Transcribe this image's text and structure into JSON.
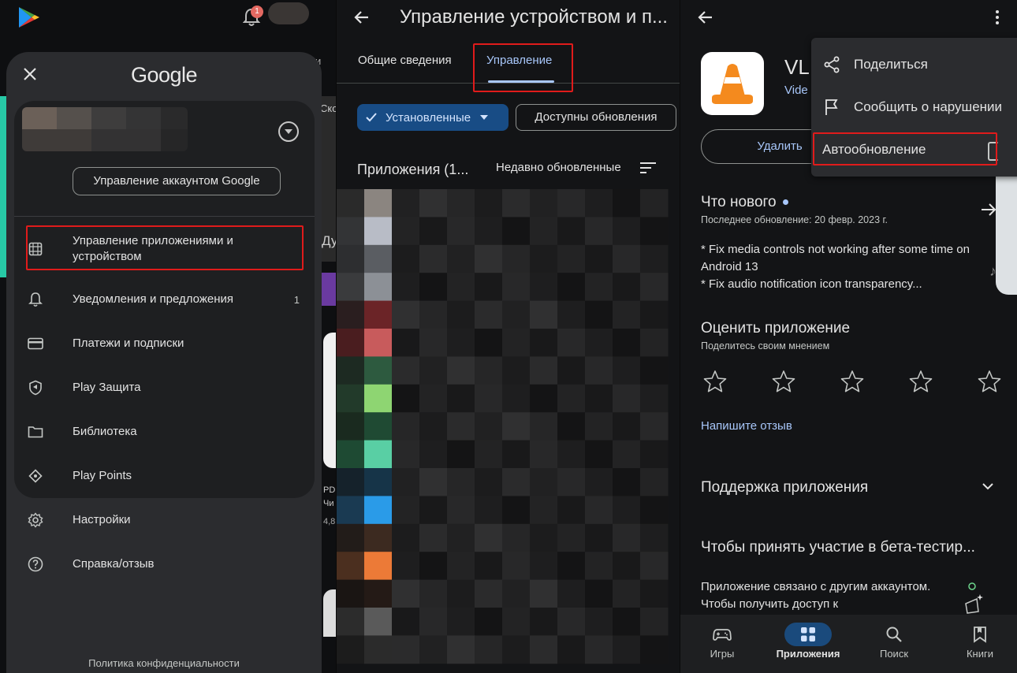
{
  "panel1": {
    "notification_count": "1",
    "drawer": {
      "logo": "Google",
      "manage_account_label": "Управление аккаунтом Google",
      "menu": [
        {
          "label": "Управление приложениями и устройством",
          "icon": "grid-icon"
        },
        {
          "label": "Уведомления и предложения",
          "icon": "bell-icon",
          "count": "1"
        },
        {
          "label": "Платежи и подписки",
          "icon": "credit-card-icon"
        },
        {
          "label": "Play Защита",
          "icon": "shield-icon"
        },
        {
          "label": "Библиотека",
          "icon": "folder-icon"
        },
        {
          "label": "Play Points",
          "icon": "diamond-icon"
        },
        {
          "label": "Настройки",
          "icon": "gear-icon"
        },
        {
          "label": "Справка/отзыв",
          "icon": "help-icon"
        }
      ],
      "privacy_link": "Политика конфиденциальности"
    },
    "background_fragments": {
      "tab_tail": "и",
      "card_label_1": "Ско",
      "card_letter": "Ду",
      "card_label_2": "PD",
      "card_label_3": "Чи",
      "card_rating": "4,8"
    }
  },
  "panel2": {
    "title": "Управление устройством и п...",
    "tabs": [
      {
        "label": "Общие сведения",
        "active": false
      },
      {
        "label": "Управление",
        "active": true
      }
    ],
    "filter_installed": "Установленные",
    "filter_updates": "Доступны обновления",
    "apps_count_label": "Приложения (1...",
    "sort_label": "Недавно обновленные",
    "accent_color": "#a8c7fa"
  },
  "panel3": {
    "app_name": "VL",
    "developer": "Vide",
    "uninstall_label": "Удалить",
    "menu": [
      {
        "label": "Поделиться",
        "icon": "share-icon"
      },
      {
        "label": "Сообщить о нарушении",
        "icon": "flag-icon"
      },
      {
        "label": "Автообновление",
        "icon": "checkbox-icon"
      }
    ],
    "whats_new_title": "Что нового",
    "last_update": "Последнее обновление: 20 февр. 2023 г.",
    "changelog": [
      "* Fix media controls not working after some time on Android 13",
      "* Fix audio notification icon transparency..."
    ],
    "rate_title": "Оценить приложение",
    "rate_subtitle": "Поделитесь своим мнением",
    "star_count": 5,
    "write_review": "Напишите отзыв",
    "support_title": "Поддержка приложения",
    "beta_title": "Чтобы принять участие в бета-тестир...",
    "beta_desc": "Приложение связано с другим аккаунтом. Чтобы получить доступ к",
    "bottom_nav": [
      {
        "label": "Игры",
        "icon": "gamepad-icon",
        "active": false
      },
      {
        "label": "Приложения",
        "icon": "apps-icon",
        "active": true
      },
      {
        "label": "Поиск",
        "icon": "search-icon",
        "active": false
      },
      {
        "label": "Книги",
        "icon": "bookmark-icon",
        "active": false
      }
    ]
  }
}
